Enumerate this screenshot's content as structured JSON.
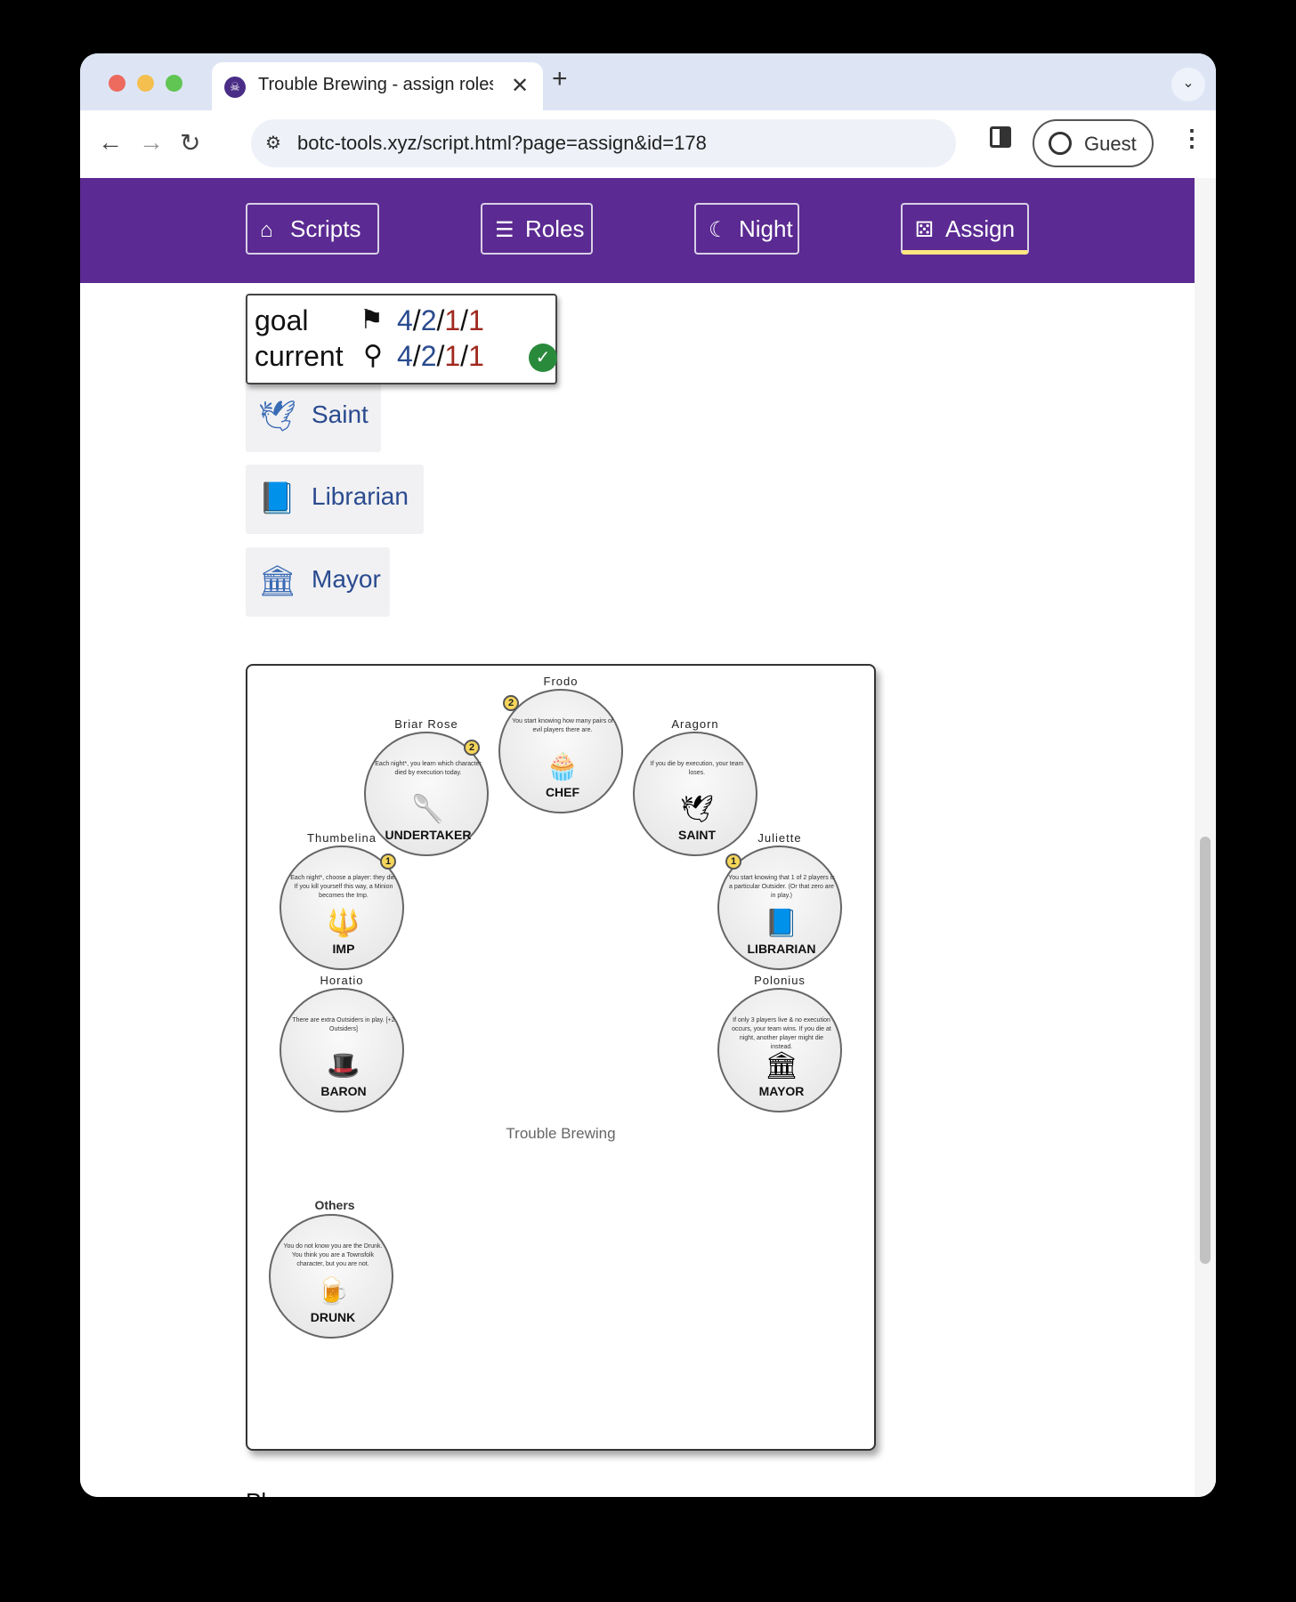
{
  "browser": {
    "tab_title": "Trouble Brewing - assign roles",
    "tab_close": "✕",
    "new_tab": "+",
    "url": "botc-tools.xyz/script.html?page=assign&id=178",
    "profile_label": "Guest",
    "back_icon": "arrow-left-icon",
    "forward_icon": "arrow-right-icon",
    "reload_icon": "reload-icon"
  },
  "nav": {
    "scripts": "Scripts",
    "roles": "Roles",
    "night": "Night",
    "assign": "Assign"
  },
  "counter": {
    "goal_label": "goal",
    "current_label": "current",
    "goal": {
      "townsfolk": "4",
      "outsiders": "2",
      "minions": "1",
      "demons": "1"
    },
    "current": {
      "townsfolk": "4",
      "outsiders": "2",
      "minions": "1",
      "demons": "1"
    },
    "sep": "/"
  },
  "role_list": [
    {
      "name": "Saint",
      "icon": "wings-icon"
    },
    {
      "name": "Librarian",
      "icon": "book-icon"
    },
    {
      "name": "Mayor",
      "icon": "building-icon"
    }
  ],
  "grimoire": {
    "script_name": "Trouble Brewing",
    "others_label": "Others",
    "tokens": [
      {
        "player": "Frodo",
        "role": "CHEF",
        "desc": "You start knowing how many pairs of evil players there are.",
        "badge": "2",
        "icon": "🧁"
      },
      {
        "player": "Briar Rose",
        "role": "UNDERTAKER",
        "desc": "Each night*, you learn which character died by execution today.",
        "badge": "2",
        "icon": "🥄"
      },
      {
        "player": "Aragorn",
        "role": "SAINT",
        "desc": "If you die by execution, your team loses.",
        "badge": "",
        "icon": "🕊"
      },
      {
        "player": "Thumbelina",
        "role": "IMP",
        "desc": "Each night*, choose a player: they die. If you kill yourself this way, a Minion becomes the Imp.",
        "badge": "1",
        "icon": "🔱"
      },
      {
        "player": "Juliette",
        "role": "LIBRARIAN",
        "desc": "You start knowing that 1 of 2 players is a particular Outsider. (Or that zero are in play.)",
        "badge": "1",
        "icon": "📘"
      },
      {
        "player": "Horatio",
        "role": "BARON",
        "desc": "There are extra Outsiders in play. [+2 Outsiders]",
        "badge": "",
        "icon": "🎩"
      },
      {
        "player": "Polonius",
        "role": "MAYOR",
        "desc": "If only 3 players live & no execution occurs, your team wins. If you die at night, another player might die instead.",
        "badge": "",
        "icon": "🏛"
      },
      {
        "player": "",
        "role": "DRUNK",
        "desc": "You do not know you are the Drunk. You think you are a Townsfolk character, but you are not.",
        "badge": "",
        "icon": "🍺"
      }
    ]
  },
  "players_label": "Players:",
  "colors": {
    "nav_bg": "#5b2a92",
    "good": "#2a4b8f",
    "evil": "#a0281e",
    "ok": "#2a8a3c"
  }
}
